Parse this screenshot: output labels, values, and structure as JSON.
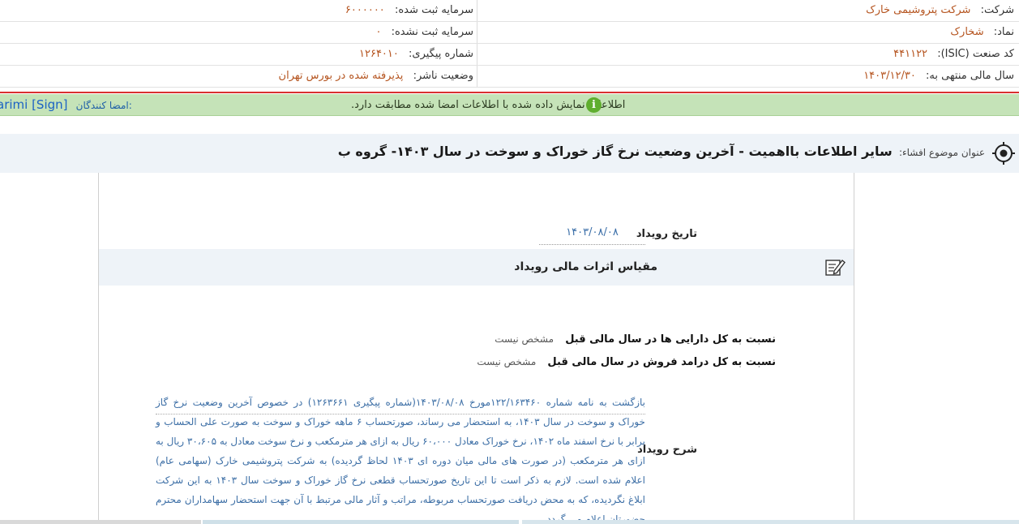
{
  "header": {
    "rows": [
      {
        "right_label": "شرکت:",
        "right_value": "شرکت پتروشیمی خارک",
        "left_label": "سرمایه ثبت شده:",
        "left_value": "۶۰۰۰۰۰۰"
      },
      {
        "right_label": "نماد:",
        "right_value": "شخارک",
        "left_label": "سرمایه ثبت نشده:",
        "left_value": "۰"
      },
      {
        "right_label": "کد صنعت (ISIC):",
        "right_value": "۴۴۱۱۲۲",
        "left_label": "شماره پیگیری:",
        "left_value": "۱۲۶۴۰۱۰"
      },
      {
        "right_label": "سال مالی منتهی به:",
        "right_value": "۱۴۰۳/۱۲/۳۰",
        "left_label": "وضعیت ناشر:",
        "left_value": "پذیرفته شده در بورس تهران"
      }
    ]
  },
  "signature_bar": {
    "signers_label": "امضا کنندگان:",
    "signers_names": "arimi [Sign]",
    "message": "اطلاعات نمایش داده شده با اطلاعات امضا شده مطابقت دارد.",
    "info_icon": "info-icon"
  },
  "subject": {
    "label": "عنوان موضوع افشاء:",
    "title": "سایر اطلاعات بااهمیت - آخرین وضعیت نرخ گاز خوراک و سوخت در سال ۱۴۰۳- گروه ب"
  },
  "event": {
    "date_label": "تاریخ رویداد",
    "date_value": "۱۴۰۳/۰۸/۰۸"
  },
  "financial_section": {
    "title": "مقیاس اثرات مالی رویداد",
    "rows": [
      {
        "label": "نسبت به کل دارایی ها در سال مالی قبل",
        "value": "مشخص نیست"
      },
      {
        "label": "نسبت به کل درامد فروش در سال مالی قبل",
        "value": "مشخص نیست"
      }
    ]
  },
  "description": {
    "label": "شرح رویداد",
    "text": "بازگشت به نامه شماره ۱۲۲/۱۶۳۴۶۰مورخ ۱۴۰۳/۰۸/۰۸(شماره پیگیری ۱۲۶۳۶۶۱) در خصوص آخرین وضعیت نرخ گاز خوراک و سوخت در سال ۱۴۰۳، به استحضار می رساند، صورتحساب ۶ ماهه خوراک و سوخت به صورت علی الحساب و برابر با نرخ اسفند ماه ۱۴۰۲، نرخ خوراک معادل ۶۰،۰۰۰ ریال به ازای هر مترمکعب و نرخ سوخت معادل به ۳۰،۶۰۵ ریال به ازای هر مترمکعب (در صورت های مالی میان دوره ای ۱۴۰۳ لحاظ گردیده) به شرکت پتروشیمی خارک (سهامی عام) اعلام شده است. لازم به ذکر است تا این تاریخ صورتحساب قطعی نرخ گاز خوراک و سوخت سال ۱۴۰۳ به این شرکت ابلاغ نگردیده، که به محض دریافت صورتحساب مربوطه، مراتب و آثار مالی مرتبط با آن جهت استحضار سهامداران محترم حضورتان اعلام می گردد."
  },
  "colors": {
    "value_orange": "#b5541f",
    "link_blue": "#3d6fa6",
    "green_bar": "#c5e3b8",
    "red_line": "#d93030",
    "panel_bg": "#eef3f8"
  }
}
